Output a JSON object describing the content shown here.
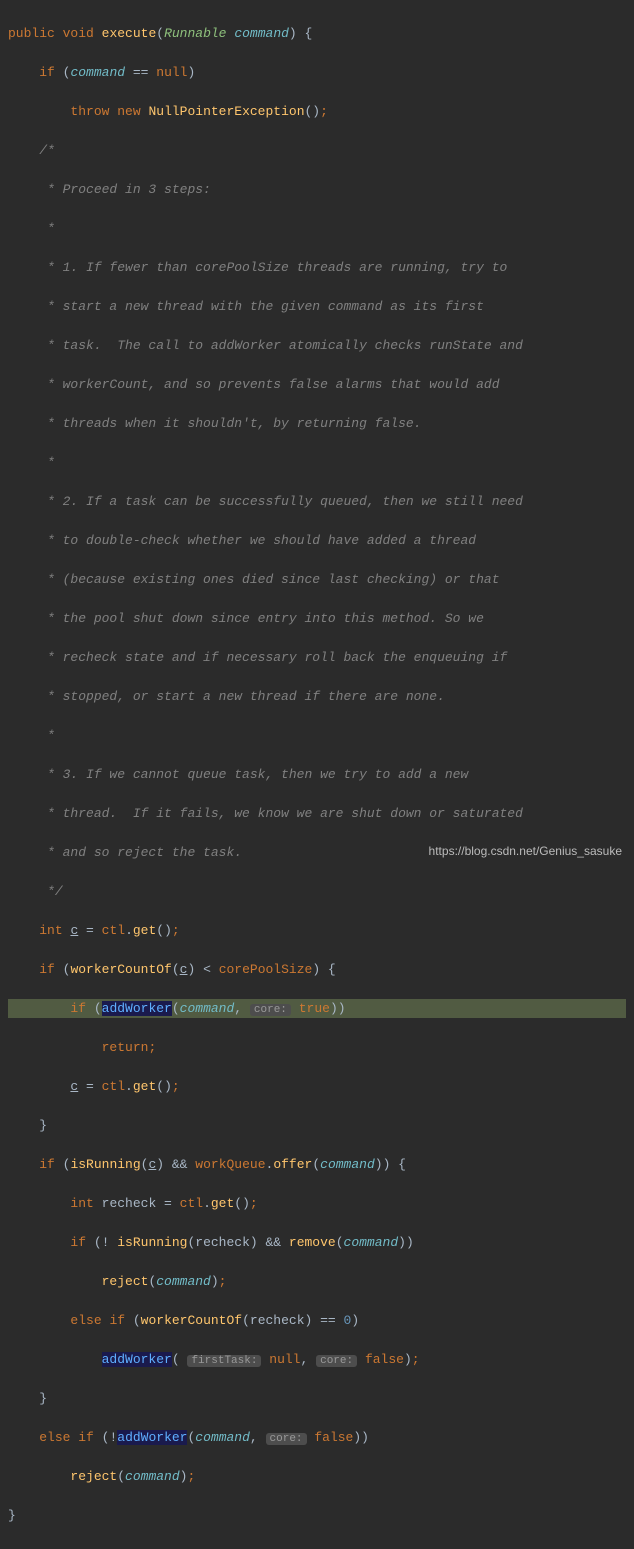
{
  "code": {
    "line1": {
      "kw_public": "public",
      "kw_void": "void",
      "method": "execute",
      "type": "Runnable",
      "param": "command"
    },
    "line2": {
      "kw_if": "if",
      "param": "command",
      "kw_null": "null"
    },
    "line3": {
      "kw_throw": "throw",
      "kw_new": "new",
      "type": "NullPointerException"
    },
    "comment_lines": [
      "/*",
      " * Proceed in 3 steps:",
      " *",
      " * 1. If fewer than corePoolSize threads are running, try to",
      " * start a new thread with the given command as its first",
      " * task.  The call to addWorker atomically checks runState and",
      " * workerCount, and so prevents false alarms that would add",
      " * threads when it shouldn't, by returning false.",
      " *",
      " * 2. If a task can be successfully queued, then we still need",
      " * to double-check whether we should have added a thread",
      " * (because existing ones died since last checking) or that",
      " * the pool shut down since entry into this method. So we",
      " * recheck state and if necessary roll back the enqueuing if",
      " * stopped, or start a new thread if there are none.",
      " *",
      " * 3. If we cannot queue task, then we try to add a new",
      " * thread.  If it fails, we know we are shut down or saturated",
      " * and so reject the task.",
      " */"
    ],
    "line24": {
      "kw_int": "int",
      "var_c": "c",
      "field": "ctl",
      "method": "get"
    },
    "line25": {
      "kw_if": "if",
      "method": "workerCountOf",
      "var_c": "c",
      "field": "corePoolSize"
    },
    "line26": {
      "kw_if": "if",
      "method": "addWorker",
      "param": "command",
      "hint": "core:",
      "kw_true": "true"
    },
    "line27": {
      "kw_return": "return"
    },
    "line28": {
      "var_c": "c",
      "field": "ctl",
      "method": "get"
    },
    "line30": {
      "kw_if": "if",
      "method1": "isRunning",
      "var_c": "c",
      "field": "workQueue",
      "method2": "offer",
      "param": "command"
    },
    "line31": {
      "kw_int": "int",
      "var": "recheck",
      "field": "ctl",
      "method": "get"
    },
    "line32": {
      "kw_if": "if",
      "method1": "isRunning",
      "var": "recheck",
      "method2": "remove",
      "param": "command"
    },
    "line33": {
      "method": "reject",
      "param": "command"
    },
    "line34": {
      "kw_else": "else",
      "kw_if": "if",
      "method": "workerCountOf",
      "var": "recheck",
      "num": "0"
    },
    "line35": {
      "method": "addWorker",
      "hint1": "firstTask:",
      "kw_null": "null",
      "hint2": "core:",
      "kw_false": "false"
    },
    "line37": {
      "kw_else": "else",
      "kw_if": "if",
      "method": "addWorker",
      "param": "command",
      "hint": "core:",
      "kw_false": "false"
    },
    "line38": {
      "method": "reject",
      "param": "command"
    }
  },
  "watermark": "https://blog.csdn.net/Genius_sasuke"
}
